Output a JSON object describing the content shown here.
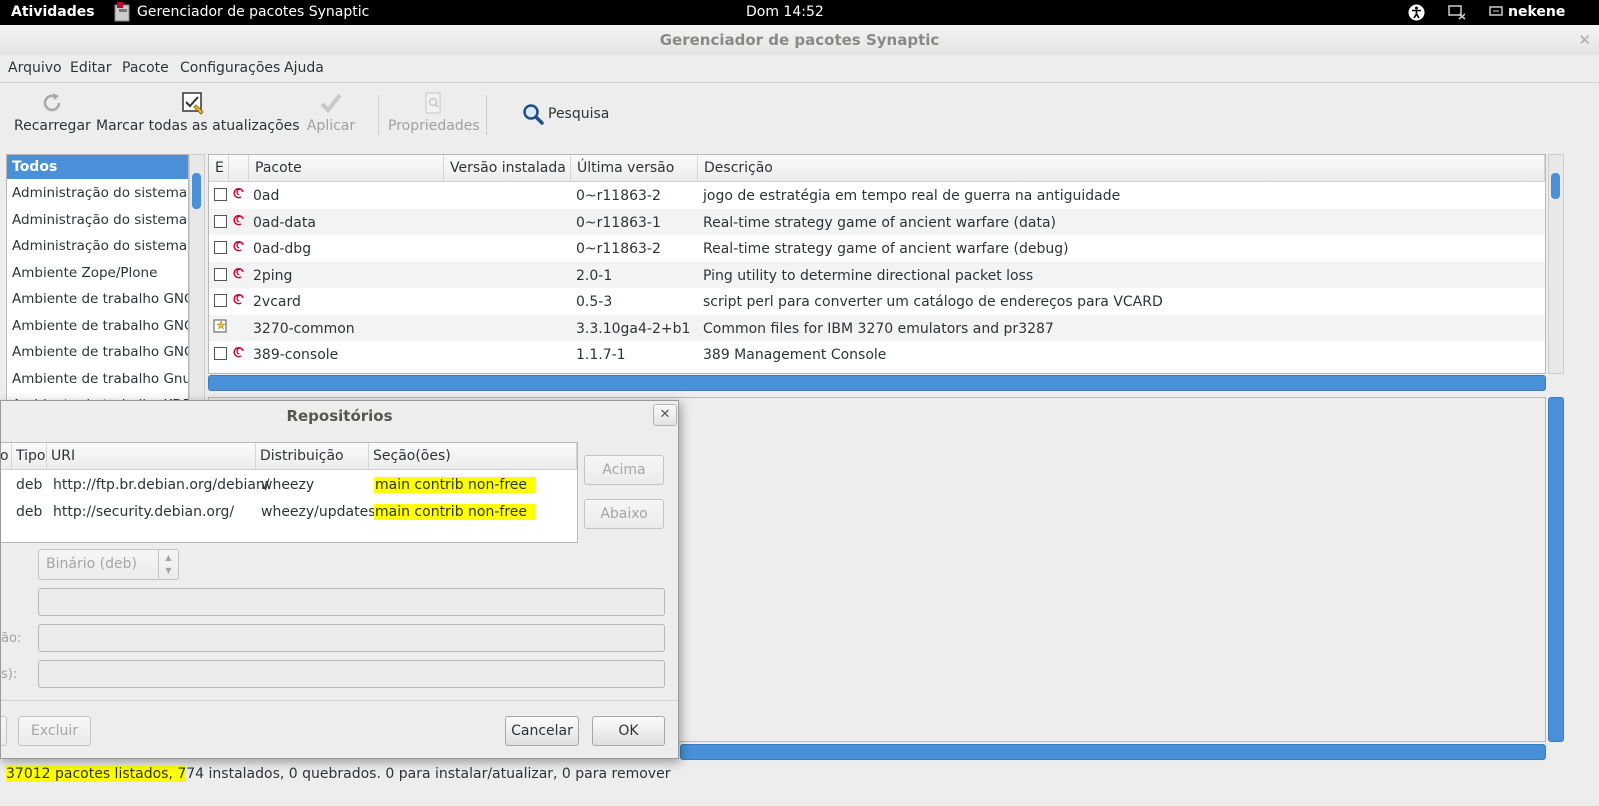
{
  "topbar": {
    "activities": "Atividades",
    "app_name": "Gerenciador de pacotes Synaptic",
    "clock": "Dom 14:52",
    "user": "nekene"
  },
  "window": {
    "title": "Gerenciador de pacotes Synaptic"
  },
  "menubar": {
    "items": [
      "Arquivo",
      "Editar",
      "Pacote",
      "Configurações",
      "Ajuda"
    ]
  },
  "toolbar": {
    "reload": "Recarregar",
    "mark_all": "Marcar todas as atualizações",
    "apply": "Aplicar",
    "properties": "Propriedades",
    "search": "Pesquisa"
  },
  "sidebar": {
    "header": "Todos",
    "items": [
      "Administração do sistema",
      "Administração do sistema (c",
      "Administração do sistema (r",
      "Ambiente Zope/Plone",
      "Ambiente de trabalho GNC",
      "Ambiente de trabalho GNC",
      "Ambiente de trabalho GNC",
      "Ambiente de trabalho Gnus",
      "Ambiente de trabalho KDE"
    ]
  },
  "packages": {
    "columns": [
      "E",
      "",
      "Pacote",
      "Versão instalada",
      "Última versão",
      "Descrição"
    ],
    "rows": [
      {
        "name": "0ad",
        "installed": "",
        "latest": "0~r11863-2",
        "description": "jogo de estratégia em tempo real de guerra na antiguidade"
      },
      {
        "name": "0ad-data",
        "installed": "",
        "latest": "0~r11863-1",
        "description": "Real-time strategy game of ancient warfare (data)"
      },
      {
        "name": "0ad-dbg",
        "installed": "",
        "latest": "0~r11863-2",
        "description": "Real-time strategy game of ancient warfare (debug)"
      },
      {
        "name": "2ping",
        "installed": "",
        "latest": "2.0-1",
        "description": "Ping utility to determine directional packet loss"
      },
      {
        "name": "2vcard",
        "installed": "",
        "latest": "0.5-3",
        "description": "script perl para converter um catálogo de endereços para VCARD"
      },
      {
        "name": "3270-common",
        "installed": "",
        "latest": "3.3.10ga4-2+b1",
        "description": "Common files for IBM 3270 emulators and pr3287"
      },
      {
        "name": "389-console",
        "installed": "",
        "latest": "1.1.7-1",
        "description": "389 Management Console"
      }
    ]
  },
  "status": {
    "listed": "37012 pacotes listados, 7",
    "rest": "74 instalados, 0 quebrados. 0 para instalar/atualizar, 0 para remover"
  },
  "dialog": {
    "title": "Repositórios",
    "columns": [
      "o",
      "Tipo",
      "URI",
      "Distribuição",
      "Seção(ões)"
    ],
    "rows": [
      {
        "type": "deb",
        "uri": "http://ftp.br.debian.org/debian/",
        "distribution": "wheezy",
        "sections": "main contrib non-free"
      },
      {
        "type": "deb",
        "uri": "http://security.debian.org/",
        "distribution": "wheezy/updates",
        "sections": "main contrib non-free"
      }
    ],
    "up_button": "Acima",
    "down_button": "Abaixo",
    "type_select": "Binário (deb)",
    "label_distribution": "ão:",
    "label_sections": "s):",
    "delete_button": "Excluir",
    "cancel_button": "Cancelar",
    "ok_button": "OK"
  },
  "colors": {
    "accent": "#4a90d9",
    "highlight": "#ffff00",
    "debian_red": "#c70036"
  }
}
